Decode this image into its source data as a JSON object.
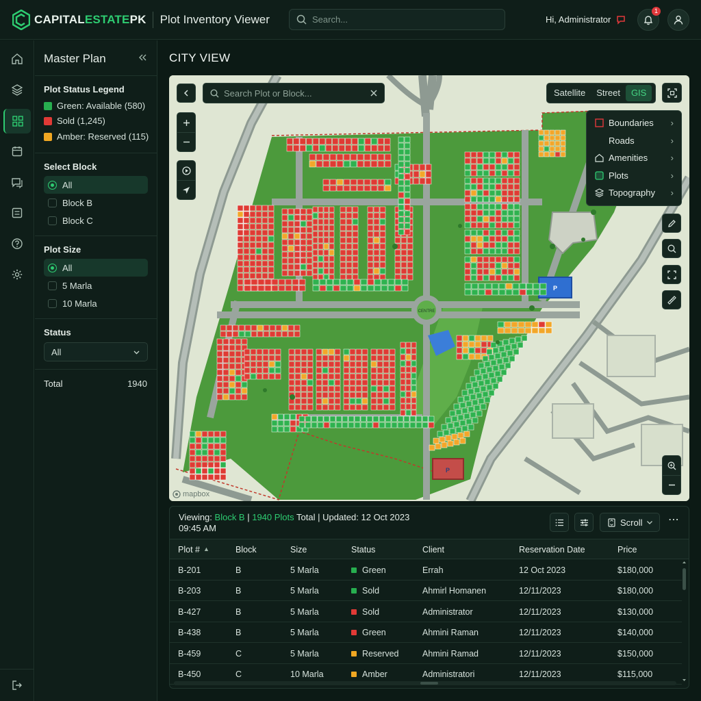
{
  "header": {
    "brand_a": "CAPITAL",
    "brand_b": "ESTATE",
    "brand_c": "PK",
    "app_title": "Plot Inventory Viewer",
    "search_placeholder": "Search...",
    "greeting": "Hi, Administrator",
    "notification_count": "1"
  },
  "rail": {
    "icons": [
      "home-icon",
      "layers-icon",
      "grid-icon",
      "calendar-icon",
      "messages-icon",
      "report-icon",
      "help-icon",
      "settings-icon",
      "logout-icon"
    ],
    "active": "grid-icon"
  },
  "panel": {
    "title": "Master Plan",
    "legend_title": "Plot Status Legend",
    "legend": [
      {
        "label": "Green: Available (580)",
        "color": "#27ae4f"
      },
      {
        "label": "Sold (1,245)",
        "color": "#e03a36"
      },
      {
        "label": "Amber: Reserved (115)",
        "color": "#f0a722"
      }
    ],
    "block_title": "Select Block",
    "blocks": [
      "All",
      "Block B",
      "Block C"
    ],
    "size_title": "Plot Size",
    "sizes": [
      "All",
      "5 Marla",
      "10 Marla"
    ],
    "status_title": "Status",
    "status_value": "All",
    "total_label": "Total",
    "total_value": "1940"
  },
  "main": {
    "title": "CITY VIEW",
    "map": {
      "search_placeholder": "Search Plot or Block...",
      "modes": [
        "Satellite",
        "Street",
        "GIS"
      ],
      "active_mode": "GIS",
      "layers": [
        "Boundaries",
        "Roads",
        "Amenities",
        "Plots",
        "Topography"
      ],
      "attribution": "mapbox",
      "roundabout_label": "CENTRE"
    },
    "table": {
      "viewing_label": "Viewing:",
      "viewing_block": "Block B",
      "plots_count": "1940 Plots",
      "total_word": "Total",
      "updated": "Updated: 12 Oct 2023",
      "time": "09:45 AM",
      "scroll_label": "Scroll",
      "columns": [
        "Plot #",
        "Block",
        "Size",
        "Status",
        "Client",
        "Reservation Date",
        "Price"
      ],
      "rows": [
        {
          "plot": "B-201",
          "block": "B",
          "size": "5 Marla",
          "status": "Green",
          "status_color": "#27ae4f",
          "client": "Errah",
          "date": "12 Oct 2023",
          "price": "$180,000"
        },
        {
          "plot": "B-203",
          "block": "B",
          "size": "5 Marla",
          "status": "Sold",
          "status_color": "#27ae4f",
          "client": "Ahmirl Homanen",
          "date": "12/11/2023",
          "price": "$180,000"
        },
        {
          "plot": "B-427",
          "block": "B",
          "size": "5 Marla",
          "status": "Sold",
          "status_color": "#e03a36",
          "client": "Administrator",
          "date": "12/11/2023",
          "price": "$130,000"
        },
        {
          "plot": "B-438",
          "block": "B",
          "size": "5 Marla",
          "status": "Green",
          "status_color": "#e03a36",
          "client": "Ahmini Raman",
          "date": "12/11/2023",
          "price": "$140,000"
        },
        {
          "plot": "B-459",
          "block": "C",
          "size": "5 Marla",
          "status": "Reserved",
          "status_color": "#f0a722",
          "client": "Ahmini Ramad",
          "date": "12/11/2023",
          "price": "$150,000"
        },
        {
          "plot": "B-450",
          "block": "C",
          "size": "10 Marla",
          "status": "Amber",
          "status_color": "#f0a722",
          "client": "Administratori",
          "date": "12/11/2023",
          "price": "$115,000"
        }
      ]
    }
  }
}
